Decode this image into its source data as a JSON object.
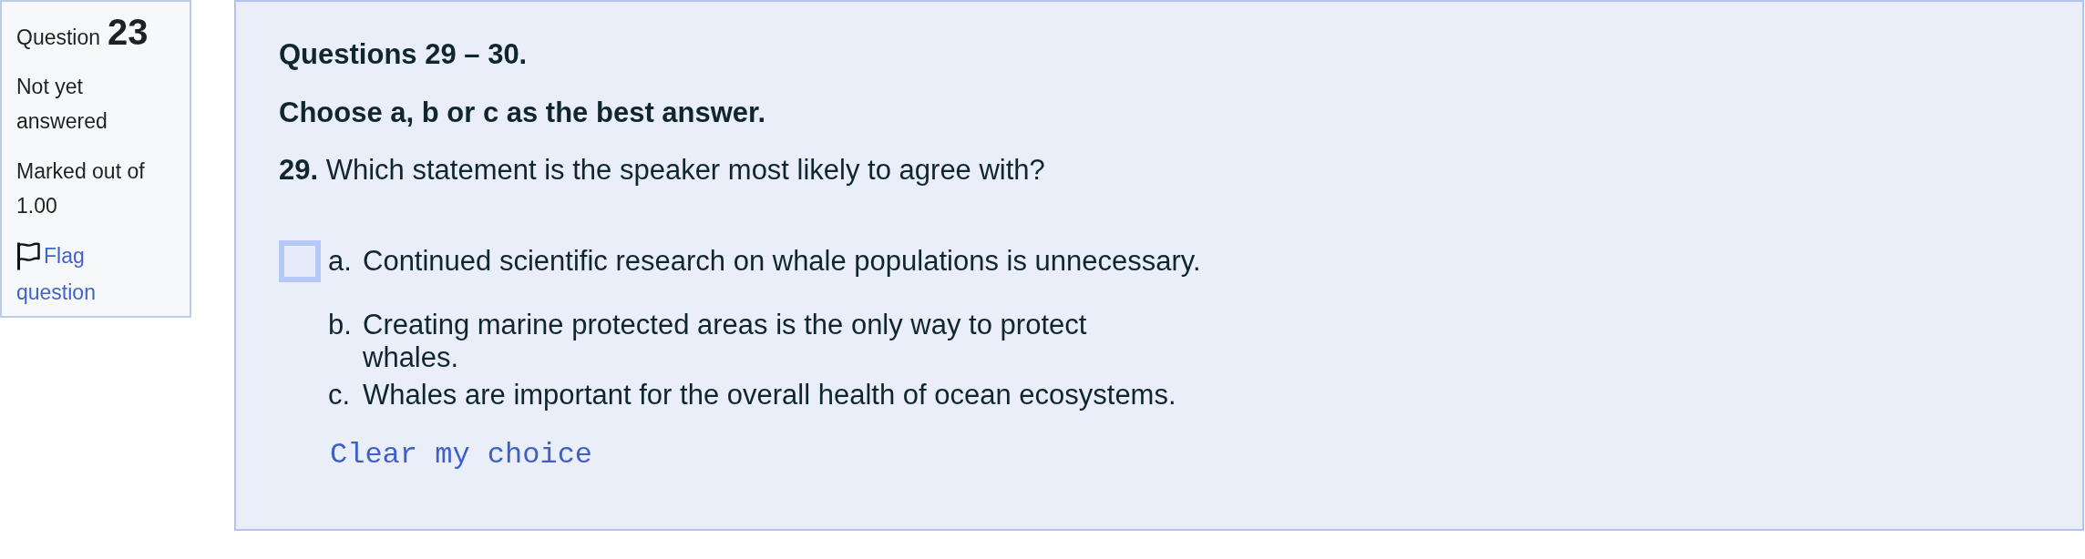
{
  "question_info": {
    "label": "Question",
    "number": "23",
    "status": "Not yet answered",
    "grade": "Marked out of 1.00",
    "flag_link": "Flag question",
    "flagged": false
  },
  "question": {
    "heading": "Questions 29 – 30.",
    "instruction": "Choose a, b or c as the best answer.",
    "prompt": "**29.** Which statement is the speaker most likely to agree with?",
    "options": [
      {
        "label": "a.",
        "text": "Continued scientific research on whale populations is unnecessary.",
        "focused": true,
        "selected": false
      },
      {
        "label": "b.",
        "text": "Creating marine protected areas is the only way to protect whales.",
        "focused": false,
        "selected": false
      },
      {
        "label": "c.",
        "text": "Whales are important for the overall health of ocean ecosystems.",
        "focused": false,
        "selected": false
      }
    ],
    "clear_link": "Clear my choice"
  }
}
